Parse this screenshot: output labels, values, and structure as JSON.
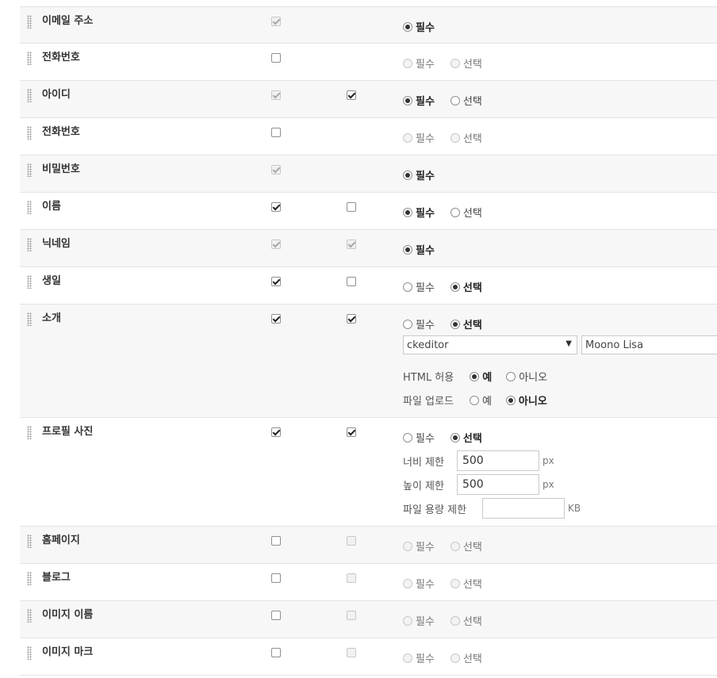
{
  "fields": [
    {
      "label": "이메일 주소",
      "cb1": {
        "checked": true,
        "disabled": true
      },
      "cb2": null,
      "radios": [
        {
          "label": "필수",
          "checked": true,
          "disabled": false
        }
      ]
    },
    {
      "label": "전화번호",
      "cb1": {
        "checked": false,
        "disabled": false
      },
      "cb2": null,
      "radios": [
        {
          "label": "필수",
          "checked": false,
          "disabled": true
        },
        {
          "label": "선택",
          "checked": false,
          "disabled": true
        }
      ]
    },
    {
      "label": "아이디",
      "cb1": {
        "checked": true,
        "disabled": true
      },
      "cb2": {
        "checked": true,
        "disabled": false
      },
      "radios": [
        {
          "label": "필수",
          "checked": true,
          "disabled": false
        },
        {
          "label": "선택",
          "checked": false,
          "disabled": false
        }
      ]
    },
    {
      "label": "전화번호",
      "cb1": {
        "checked": false,
        "disabled": false
      },
      "cb2": null,
      "radios": [
        {
          "label": "필수",
          "checked": false,
          "disabled": true
        },
        {
          "label": "선택",
          "checked": false,
          "disabled": true
        }
      ]
    },
    {
      "label": "비밀번호",
      "cb1": {
        "checked": true,
        "disabled": true
      },
      "cb2": null,
      "radios": [
        {
          "label": "필수",
          "checked": true,
          "disabled": false
        }
      ]
    },
    {
      "label": "이름",
      "cb1": {
        "checked": true,
        "disabled": false
      },
      "cb2": {
        "checked": false,
        "disabled": false
      },
      "radios": [
        {
          "label": "필수",
          "checked": true,
          "disabled": false
        },
        {
          "label": "선택",
          "checked": false,
          "disabled": false
        }
      ]
    },
    {
      "label": "닉네임",
      "cb1": {
        "checked": true,
        "disabled": true
      },
      "cb2": {
        "checked": true,
        "disabled": true
      },
      "radios": [
        {
          "label": "필수",
          "checked": true,
          "disabled": false
        }
      ]
    },
    {
      "label": "생일",
      "cb1": {
        "checked": true,
        "disabled": false
      },
      "cb2": {
        "checked": false,
        "disabled": false
      },
      "radios": [
        {
          "label": "필수",
          "checked": false,
          "disabled": false
        },
        {
          "label": "선택",
          "checked": true,
          "disabled": false
        }
      ]
    },
    {
      "label": "소개",
      "cb1": {
        "checked": true,
        "disabled": false
      },
      "cb2": {
        "checked": true,
        "disabled": false
      },
      "radios": [
        {
          "label": "필수",
          "checked": false,
          "disabled": false
        },
        {
          "label": "선택",
          "checked": true,
          "disabled": false
        }
      ],
      "editor": {
        "select_value": "ckeditor",
        "skin_value": "Moono Lisa",
        "html_allow_label": "HTML 허용",
        "html_allow_options": [
          {
            "label": "예",
            "checked": true
          },
          {
            "label": "아니오",
            "checked": false
          }
        ],
        "upload_label": "파일 업로드",
        "upload_options": [
          {
            "label": "예",
            "checked": false
          },
          {
            "label": "아니오",
            "checked": true
          }
        ]
      }
    },
    {
      "label": "프로필 사진",
      "cb1": {
        "checked": true,
        "disabled": false
      },
      "cb2": {
        "checked": true,
        "disabled": false
      },
      "radios": [
        {
          "label": "필수",
          "checked": false,
          "disabled": false
        },
        {
          "label": "선택",
          "checked": true,
          "disabled": false
        }
      ],
      "image": {
        "width_label": "너비 제한",
        "width_value": "500",
        "width_unit": "px",
        "height_label": "높이 제한",
        "height_value": "500",
        "height_unit": "px",
        "size_label": "파일 용량 제한",
        "size_value": "",
        "size_unit": "KB"
      }
    },
    {
      "label": "홈페이지",
      "cb1": {
        "checked": false,
        "disabled": false
      },
      "cb2": {
        "checked": false,
        "disabled": true
      },
      "radios": [
        {
          "label": "필수",
          "checked": false,
          "disabled": true
        },
        {
          "label": "선택",
          "checked": false,
          "disabled": true
        }
      ]
    },
    {
      "label": "블로그",
      "cb1": {
        "checked": false,
        "disabled": false
      },
      "cb2": {
        "checked": false,
        "disabled": true
      },
      "radios": [
        {
          "label": "필수",
          "checked": false,
          "disabled": true
        },
        {
          "label": "선택",
          "checked": false,
          "disabled": true
        }
      ]
    },
    {
      "label": "이미지 이름",
      "cb1": {
        "checked": false,
        "disabled": false
      },
      "cb2": {
        "checked": false,
        "disabled": true
      },
      "radios": [
        {
          "label": "필수",
          "checked": false,
          "disabled": true
        },
        {
          "label": "선택",
          "checked": false,
          "disabled": true
        }
      ]
    },
    {
      "label": "이미지 마크",
      "cb1": {
        "checked": false,
        "disabled": false
      },
      "cb2": {
        "checked": false,
        "disabled": true
      },
      "radios": [
        {
          "label": "필수",
          "checked": false,
          "disabled": true
        },
        {
          "label": "선택",
          "checked": false,
          "disabled": true
        }
      ]
    }
  ]
}
